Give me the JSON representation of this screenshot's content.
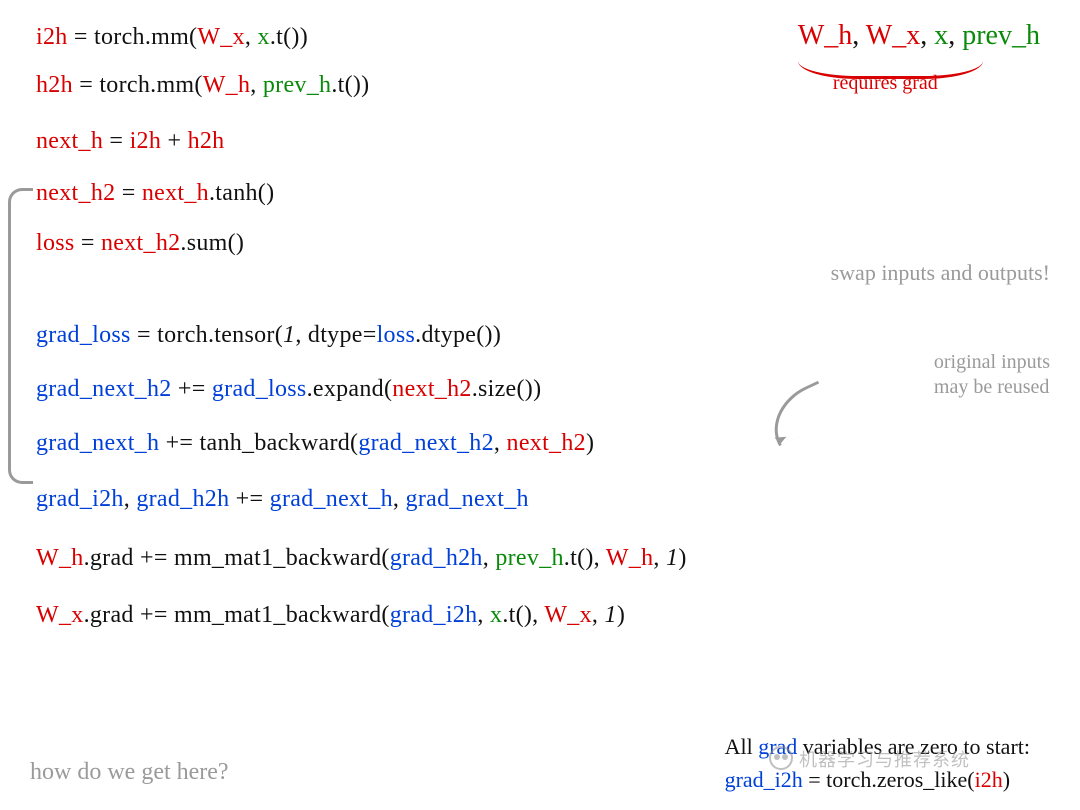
{
  "legend": {
    "wh": "W_h",
    "wx": "W_x",
    "x": "x",
    "prevh": "prev_h",
    "note": "requires grad",
    "sep": ", "
  },
  "code": {
    "l1": {
      "a": "i2h",
      "b": " = torch.mm(",
      "c": "W_x",
      "d": ", ",
      "e": "x",
      "f": ".t())"
    },
    "l2": {
      "a": "h2h",
      "b": " = torch.mm(",
      "c": "W_h",
      "d": ", ",
      "e": "prev_h",
      "f": ".t())"
    },
    "l3": {
      "a": "next_h",
      "b": " = ",
      "c": "i2h",
      "d": " + ",
      "e": "h2h"
    },
    "l4": {
      "a": "next_h2",
      "b": " = ",
      "c": "next_h",
      "d": ".tanh()"
    },
    "l5": {
      "a": "loss",
      "b": " = ",
      "c": "next_h2",
      "d": ".sum()"
    },
    "l6": {
      "a": "grad_loss",
      "b": " = torch.tensor(",
      "c": "1",
      "d": ", dtype=",
      "e": "loss",
      "f": ".dtype())"
    },
    "l7": {
      "a": "grad_next_h2",
      "b": " += ",
      "c": "grad_loss",
      "d": ".expand(",
      "e": "next_h2",
      "f": ".size())"
    },
    "l8": {
      "a": "grad_next_h",
      "b": " += tanh_backward(",
      "c": "grad_next_h2",
      "d": ", ",
      "e": "next_h2",
      "f": ")"
    },
    "l9": {
      "a": "grad_i2h",
      "b": ", ",
      "c": "grad_h2h",
      "d": " += ",
      "e": "grad_next_h",
      "f": ", ",
      "g": "grad_next_h"
    },
    "l10": {
      "a": "W_h",
      "b": ".grad += mm_mat1_backward(",
      "c": "grad_h2h",
      "d": ", ",
      "e": "prev_h",
      "f": ".t(), ",
      "g": "W_h",
      "h": ", ",
      "i": "1",
      "j": ")"
    },
    "l11": {
      "a": "W_x",
      "b": ".grad += mm_mat1_backward(",
      "c": "grad_i2h",
      "d": ", ",
      "e": "x",
      "f": ".t(), ",
      "g": "W_x",
      "h": ", ",
      "i": "1",
      "j": ")"
    }
  },
  "annotations": {
    "swap": "swap inputs and outputs!",
    "reuse1": "original inputs",
    "reuse2": "may be reused",
    "how": "how do we get here?",
    "zero1a": "All ",
    "zero1b": "grad",
    "zero1c": " variables are zero to start:",
    "zero2a": "grad_i2h",
    "zero2b": " = torch.zeros_like(",
    "zero2c": "i2h",
    "zero2d": ")"
  },
  "watermark": "机器学习与推荐系统"
}
